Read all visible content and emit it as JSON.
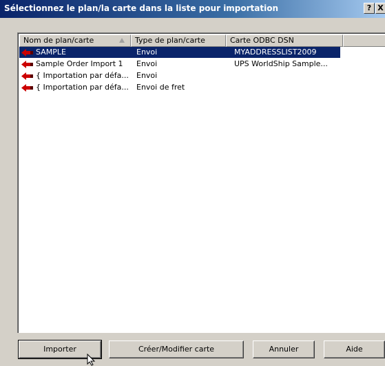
{
  "title": "Sélectionnez le plan/la carte dans la liste pour importation",
  "titlebar_buttons": {
    "help": "?",
    "close": "X"
  },
  "columns": [
    "Nom de plan/carte",
    "Type de plan/carte",
    "Carte ODBC DSN"
  ],
  "rows": [
    {
      "name": "SAMPLE",
      "type": "Envoi",
      "dsn": "MYADDRESSLIST2009",
      "selected": true
    },
    {
      "name": "Sample Order Import 1",
      "type": "Envoi",
      "dsn": "UPS WorldShip Sample..."
    },
    {
      "name": "{ Importation par défa...",
      "type": "Envoi",
      "dsn": ""
    },
    {
      "name": "{ Importation par défa...",
      "type": "Envoi de fret",
      "dsn": ""
    }
  ],
  "buttons": {
    "import": "Importer",
    "create_modify": "Créer/Modifier carte",
    "cancel": "Annuler",
    "help": "Aide"
  },
  "colors": {
    "title_bar": "#0a246a",
    "selection": "#0a246a",
    "row_icon": "#cc0000"
  },
  "icons": {
    "row": "red-arrow-icon",
    "cursor": "mouse-pointer-icon"
  }
}
